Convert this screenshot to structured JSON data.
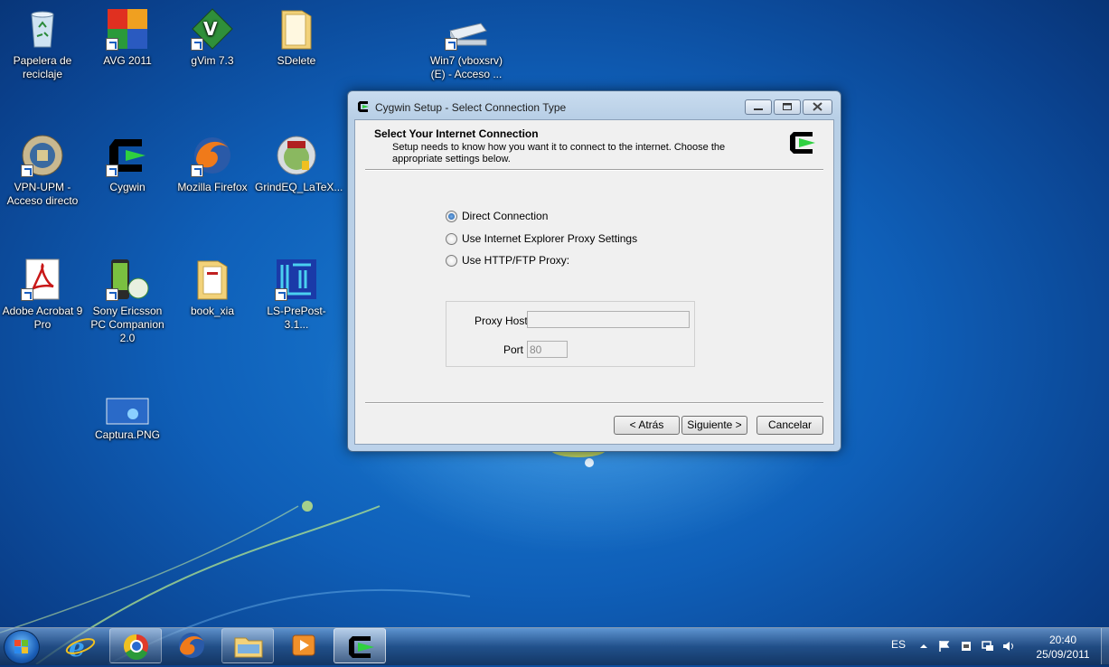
{
  "desktop": {
    "icons": [
      {
        "label": "Papelera de reciclaje",
        "icon": "recycle-bin-icon"
      },
      {
        "label": "AVG 2011",
        "icon": "avg-icon"
      },
      {
        "label": "gVim 7.3",
        "icon": "gvim-icon"
      },
      {
        "label": "SDelete",
        "icon": "folder-icon"
      },
      {
        "label": "Win7 (vboxsrv) (E) - Acceso ...",
        "icon": "network-drive-icon"
      },
      {
        "label": "VPN-UPM - Acceso directo",
        "icon": "vpn-upm-icon"
      },
      {
        "label": "Cygwin",
        "icon": "cygwin-icon"
      },
      {
        "label": "Mozilla Firefox",
        "icon": "firefox-icon"
      },
      {
        "label": "GrindEQ_LaTeX...",
        "icon": "grindeq-icon"
      },
      {
        "label": "Adobe Acrobat 9 Pro",
        "icon": "acrobat-icon"
      },
      {
        "label": "Sony Ericsson PC Companion 2.0",
        "icon": "sony-ericsson-icon"
      },
      {
        "label": "book_xia",
        "icon": "folder-icon"
      },
      {
        "label": "LS-PrePost-3.1...",
        "icon": "ls-prepost-icon"
      },
      {
        "label": "Captura.PNG",
        "icon": "image-file-icon"
      }
    ]
  },
  "dialog": {
    "title": "Cygwin Setup - Select Connection Type",
    "header_title": "Select Your Internet Connection",
    "header_desc": "Setup needs to know how you want it to connect to the internet.  Choose the appropriate settings below.",
    "options": [
      {
        "label": "Direct Connection",
        "selected": true
      },
      {
        "label": "Use Internet Explorer Proxy Settings",
        "selected": false
      },
      {
        "label": "Use HTTP/FTP Proxy:",
        "selected": false
      }
    ],
    "proxy_host_label": "Proxy Host",
    "proxy_host_value": "",
    "port_label": "Port",
    "port_value": "80",
    "back_button": "< Atrás",
    "next_button": "Siguiente >",
    "cancel_button": "Cancelar"
  },
  "taskbar": {
    "language": "ES",
    "time": "20:40",
    "date": "25/09/2011",
    "items": [
      "internet-explorer-icon",
      "chrome-icon",
      "firefox-icon",
      "explorer-icon",
      "media-player-icon",
      "cygwin-icon"
    ]
  },
  "colors": {
    "desktop_blue": "#0f5fb8",
    "dialog_frame": "#bcd2ea",
    "client_bg": "#f0f0f0"
  }
}
